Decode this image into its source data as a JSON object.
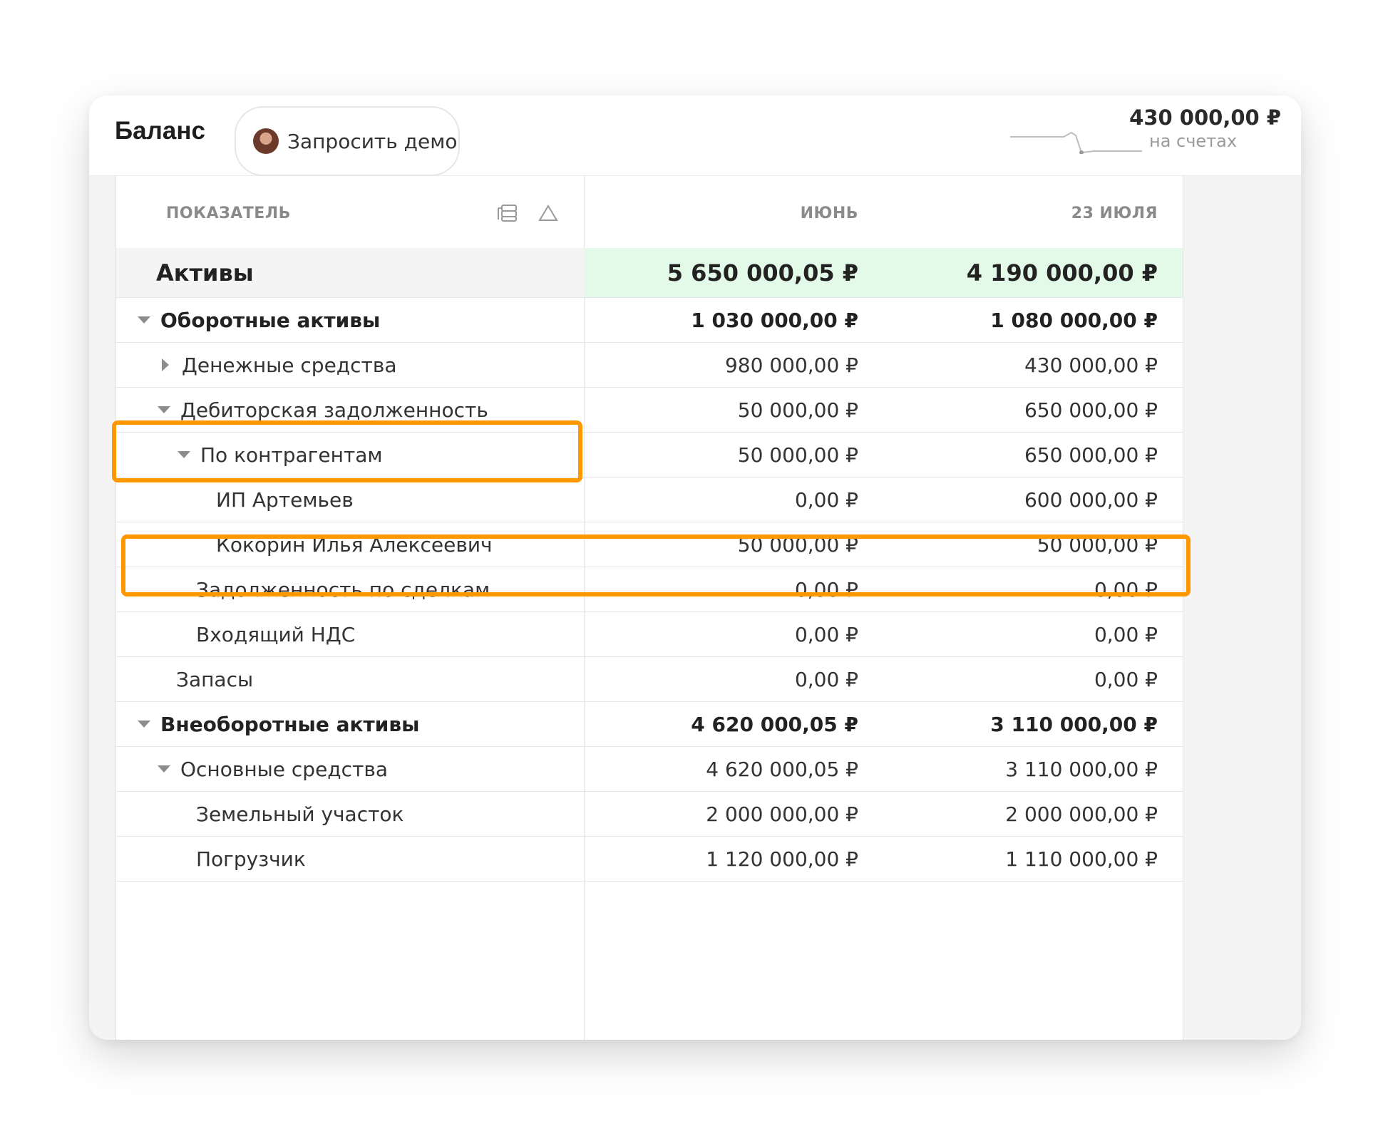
{
  "header": {
    "title": "Баланс",
    "demo_button": "Запросить демо",
    "balance_amount": "430 000,00 ₽",
    "balance_caption": "на счетах"
  },
  "table": {
    "columns": [
      "ПОКАЗАТЕЛЬ",
      "ИЮНЬ",
      "23 ИЮЛЯ"
    ],
    "rows": [
      {
        "label": "Активы",
        "june": "5 650 000,05 ₽",
        "july": "4 190 000,00 ₽"
      },
      {
        "label": "Оборотные активы",
        "june": "1 030 000,00 ₽",
        "july": "1 080 000,00 ₽"
      },
      {
        "label": "Денежные средства",
        "june": "980 000,00 ₽",
        "july": "430 000,00 ₽"
      },
      {
        "label": "Дебиторская задолженность",
        "june": "50 000,00 ₽",
        "july": "650 000,00 ₽"
      },
      {
        "label": "По контрагентам",
        "june": "50 000,00 ₽",
        "july": "650 000,00 ₽"
      },
      {
        "label": "ИП Артемьев",
        "june": "0,00 ₽",
        "july": "600 000,00 ₽"
      },
      {
        "label": "Кокорин Илья Алексеевич",
        "june": "50 000,00 ₽",
        "july": "50 000,00 ₽"
      },
      {
        "label": "Задолженность по сделкам",
        "june": "0,00 ₽",
        "july": "0,00 ₽"
      },
      {
        "label": "Входящий НДС",
        "june": "0,00 ₽",
        "july": "0,00 ₽"
      },
      {
        "label": "Запасы",
        "june": "0,00 ₽",
        "july": "0,00 ₽"
      },
      {
        "label": "Внеоборотные активы",
        "june": "4 620 000,05 ₽",
        "july": "3 110 000,00 ₽"
      },
      {
        "label": "Основные средства",
        "june": "4 620 000,05 ₽",
        "july": "3 110 000,00 ₽"
      },
      {
        "label": "Земельный участок",
        "june": "2 000 000,00 ₽",
        "july": "2 000 000,00 ₽"
      },
      {
        "label": "Погрузчик",
        "june": "1 120 000,00 ₽",
        "july": "1 110 000,00 ₽"
      }
    ]
  },
  "colors": {
    "highlight": "#ff9800",
    "total_bg": "#e4fae9",
    "caret": "#8c8c8c"
  }
}
